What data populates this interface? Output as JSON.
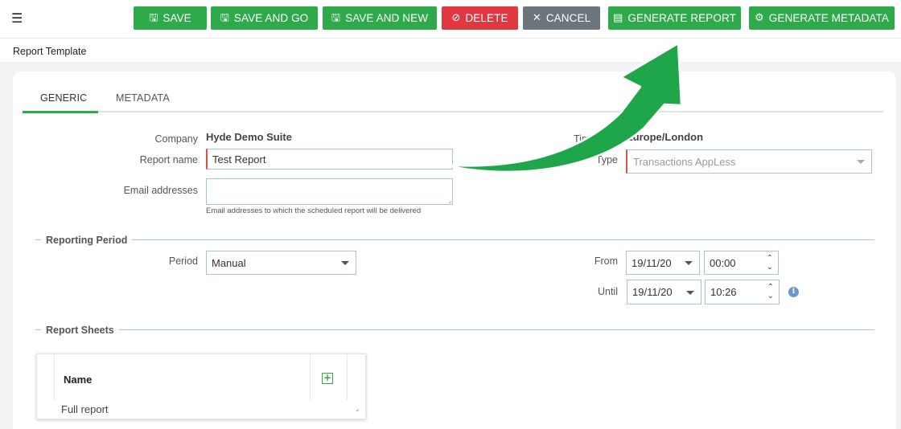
{
  "toolbar": {
    "menu_icon": "☰",
    "save": "SAVE",
    "save_and_go": "SAVE AND GO",
    "save_and_new": "SAVE AND NEW",
    "delete": "DELETE",
    "cancel": "CANCEL",
    "generate_report": "GENERATE REPORT",
    "generate_metadata": "GENERATE METADATA"
  },
  "icons": {
    "save": "floppy-disk-icon",
    "delete": "ban-icon",
    "cancel": "close-icon",
    "report": "document-icon",
    "metadata": "gear-icon",
    "add": "plus-square-icon",
    "info": "info-icon"
  },
  "colors": {
    "accent": "#2eaa4a",
    "danger": "#e0383e",
    "neutral": "#6c757d",
    "annotation_arrow": "#1fa64b"
  },
  "breadcrumb": "Report Template",
  "tabs": [
    {
      "label": "GENERIC",
      "active": true
    },
    {
      "label": "METADATA",
      "active": false
    }
  ],
  "form": {
    "company_label": "Company",
    "company_value": "Hyde Demo Suite",
    "report_name_label": "Report name",
    "report_name_value": "Test Report",
    "email_label": "Email addresses",
    "email_value": "",
    "email_help": "Email addresses to which the scheduled report will be delivered",
    "timezone_label": "Time",
    "timezone_value": "Europe/London",
    "type_label": "Type",
    "type_value": "Transactions AppLess"
  },
  "reporting_period": {
    "title": "Reporting Period",
    "period_label": "Period",
    "period_value": "Manual",
    "from_label": "From",
    "from_date": "19/11/20",
    "from_time": "00:00",
    "until_label": "Until",
    "until_date": "19/11/20",
    "until_time": "10:26"
  },
  "report_sheets": {
    "title": "Report Sheets",
    "column_name": "Name",
    "rows": [
      "Full report"
    ]
  }
}
